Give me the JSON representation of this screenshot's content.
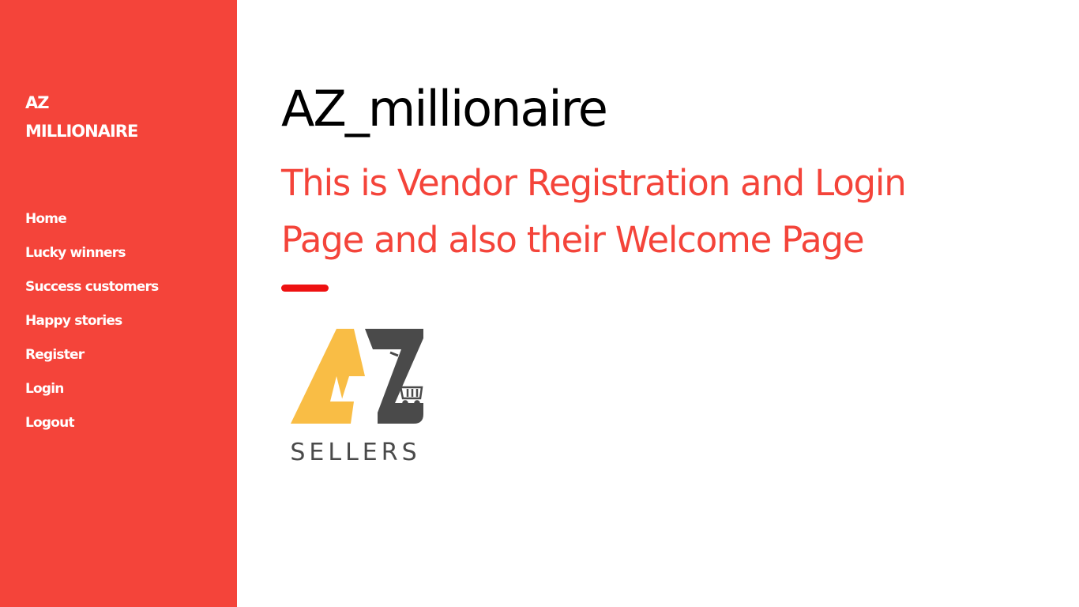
{
  "sidebar": {
    "brand_line1": "AZ",
    "brand_line2": "MILLIONAIRE",
    "nav": [
      {
        "label": "Home"
      },
      {
        "label": "Lucky winners"
      },
      {
        "label": "Success customers"
      },
      {
        "label": "Happy stories"
      },
      {
        "label": "Register"
      },
      {
        "label": "Login"
      },
      {
        "label": "Logout"
      }
    ]
  },
  "main": {
    "title": "AZ_millionaire",
    "subtitle_line1": "This is Vendor Registration and Login",
    "subtitle_line2": "Page and also their Welcome Page"
  },
  "logo": {
    "text": "SELLERS",
    "colors": {
      "yellow": "#f9bd45",
      "dark": "#4a4a4a"
    }
  },
  "colors": {
    "accent": "#f4443a",
    "bar": "#ee1111",
    "title": "#000000",
    "background": "#ffffff"
  }
}
